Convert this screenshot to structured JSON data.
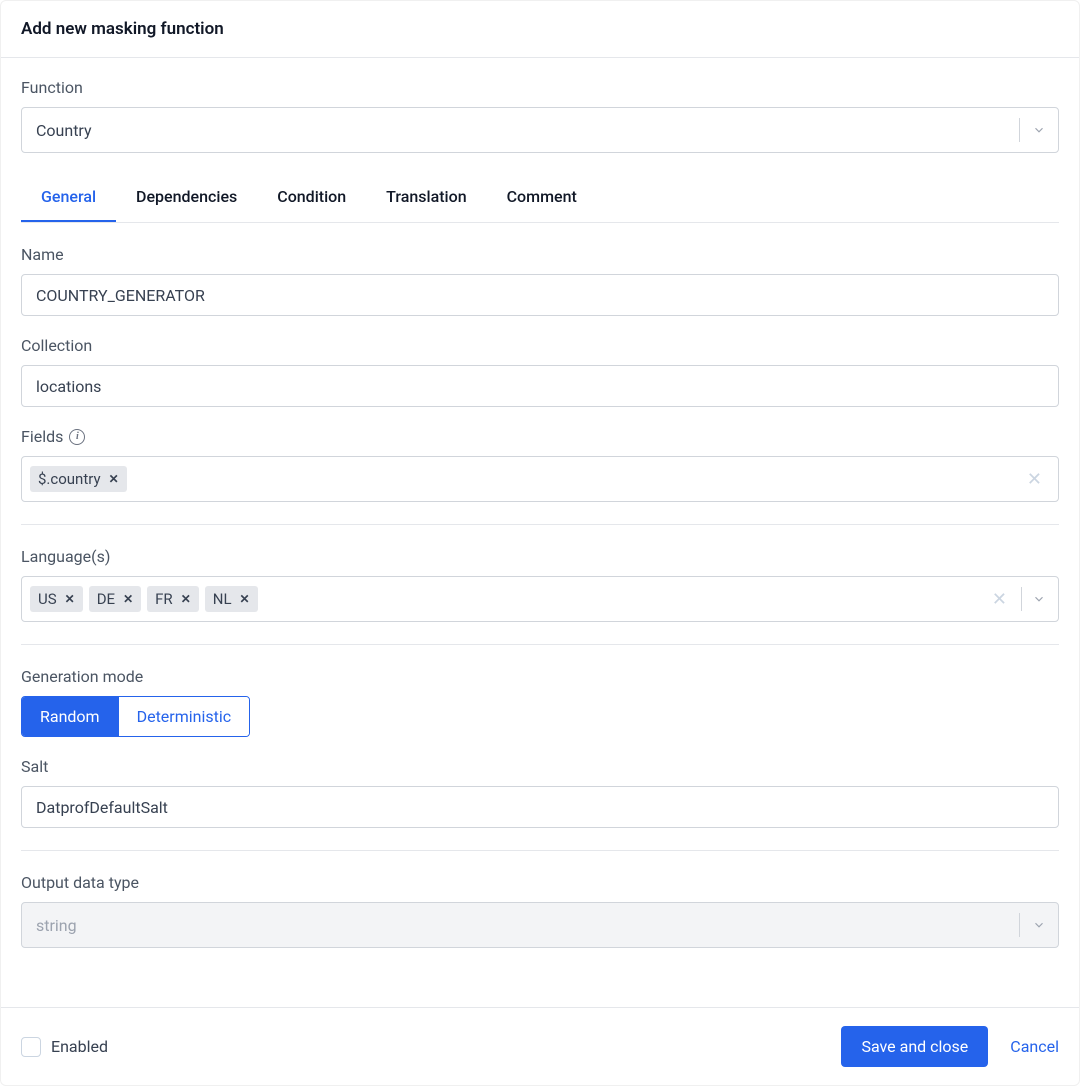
{
  "header": {
    "title": "Add new masking function"
  },
  "function_select": {
    "label": "Function",
    "value": "Country"
  },
  "tabs": [
    {
      "label": "General",
      "active": true
    },
    {
      "label": "Dependencies",
      "active": false
    },
    {
      "label": "Condition",
      "active": false
    },
    {
      "label": "Translation",
      "active": false
    },
    {
      "label": "Comment",
      "active": false
    }
  ],
  "name_field": {
    "label": "Name",
    "value": "COUNTRY_GENERATOR"
  },
  "collection_field": {
    "label": "Collection",
    "value": "locations"
  },
  "fields_field": {
    "label": "Fields",
    "tags": [
      "$.country"
    ]
  },
  "languages_field": {
    "label": "Language(s)",
    "tags": [
      "US",
      "DE",
      "FR",
      "NL"
    ]
  },
  "generation_mode": {
    "label": "Generation mode",
    "options": [
      {
        "label": "Random",
        "active": true
      },
      {
        "label": "Deterministic",
        "active": false
      }
    ]
  },
  "salt_field": {
    "label": "Salt",
    "value": "DatprofDefaultSalt"
  },
  "output_type": {
    "label": "Output data type",
    "value": "string"
  },
  "footer": {
    "enabled_label": "Enabled",
    "save_label": "Save and close",
    "cancel_label": "Cancel"
  }
}
